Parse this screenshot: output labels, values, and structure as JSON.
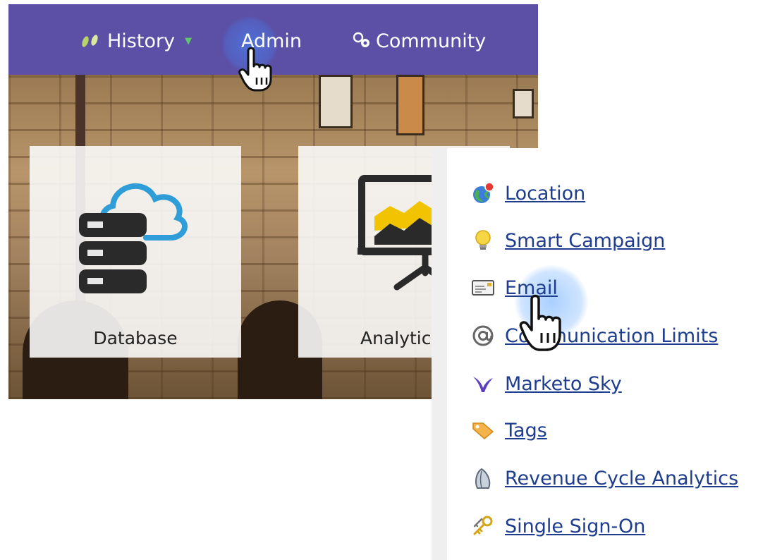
{
  "nav": {
    "history_label": "History",
    "admin_label": "Admin",
    "community_label": "Community",
    "bar_color": "#5c4fa6"
  },
  "tiles": [
    {
      "label": "Database",
      "icon": "database-cloud-icon"
    },
    {
      "label": "Analytic",
      "icon": "analytics-presentation-icon"
    }
  ],
  "menu": {
    "items": [
      {
        "label": "Location",
        "icon": "globe-icon"
      },
      {
        "label": "Smart Campaign",
        "icon": "lightbulb-icon"
      },
      {
        "label": "Email",
        "icon": "email-icon"
      },
      {
        "label": "Communication Limits",
        "icon": "at-sign-icon"
      },
      {
        "label": "Marketo Sky",
        "icon": "bird-icon"
      },
      {
        "label": "Tags",
        "icon": "tag-icon"
      },
      {
        "label": "Revenue Cycle Analytics",
        "icon": "rca-icon"
      },
      {
        "label": "Single Sign-On",
        "icon": "keys-icon"
      }
    ],
    "link_color": "#1e3d8f"
  }
}
